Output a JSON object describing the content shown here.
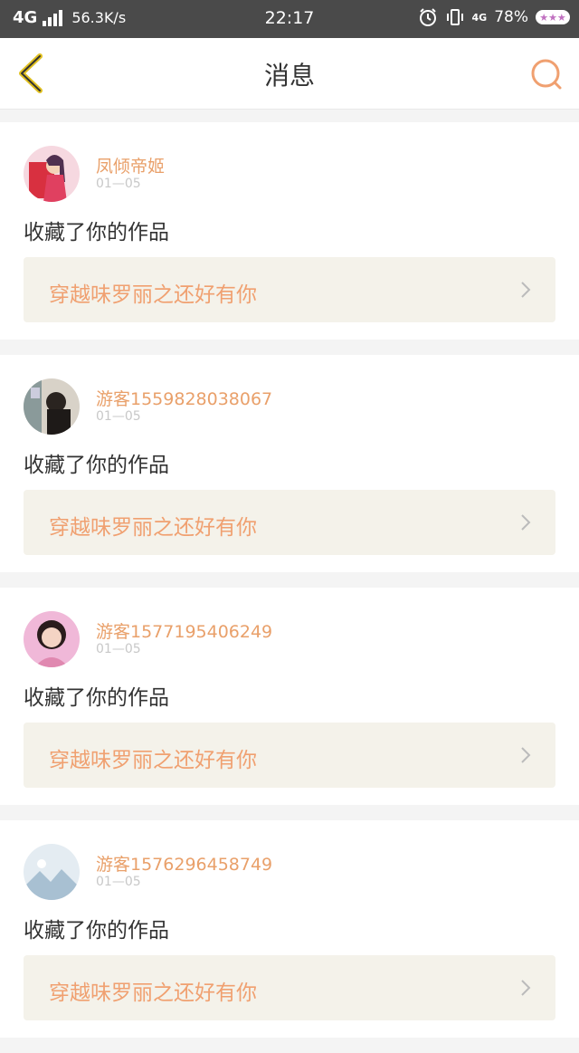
{
  "status_bar": {
    "network": "4G",
    "speed": "56.3K/s",
    "time": "22:17",
    "net_right": "4G",
    "battery": "78%"
  },
  "header": {
    "title": "消息"
  },
  "colors": {
    "accent": "#f0a070",
    "back_icon": "#e0c020",
    "card_link_bg": "#f4f2ea"
  },
  "messages": [
    {
      "username": "凤倾帝姬",
      "date": "01—05",
      "action": "收藏了你的作品",
      "work_title": "穿越味罗丽之还好有你",
      "avatar": "avatar-girl-red"
    },
    {
      "username": "游客1559828038067",
      "date": "01—05",
      "action": "收藏了你的作品",
      "work_title": "穿越味罗丽之还好有你",
      "avatar": "avatar-photo-dark"
    },
    {
      "username": "游客1577195406249",
      "date": "01—05",
      "action": "收藏了你的作品",
      "work_title": "穿越味罗丽之还好有你",
      "avatar": "avatar-woman-pink"
    },
    {
      "username": "游客1576296458749",
      "date": "01—05",
      "action": "收藏了你的作品",
      "work_title": "穿越味罗丽之还好有你",
      "avatar": "avatar-placeholder-mountain"
    }
  ]
}
